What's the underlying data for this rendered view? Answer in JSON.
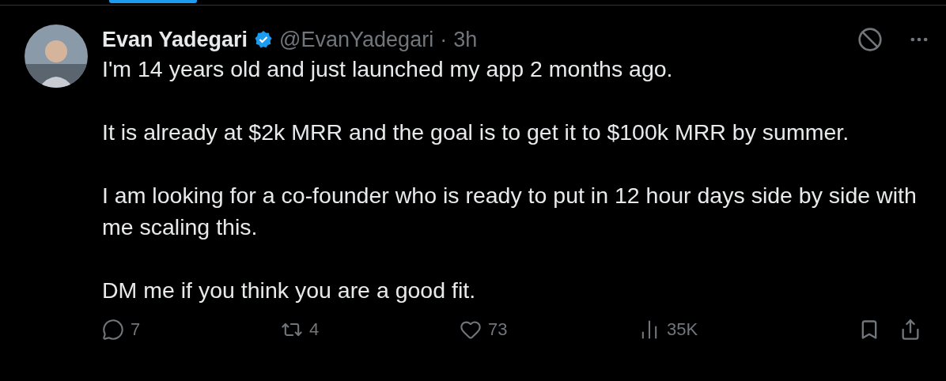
{
  "author": {
    "name": "Evan Yadegari",
    "verified": true,
    "handle": "@EvanYadegari",
    "separator": "·",
    "time": "3h"
  },
  "paragraphs": [
    "I'm 14 years old and just launched my app 2 months ago.",
    "It is already at $2k MRR and the goal is to get it to $100k MRR by summer.",
    "I am looking for a co-founder who is ready to put in 12 hour days side by side with me scaling this.",
    "DM me if you think you are a good fit."
  ],
  "actions": [
    {
      "kind": "reply",
      "count": "7"
    },
    {
      "kind": "repost",
      "count": "4"
    },
    {
      "kind": "like",
      "count": "73"
    },
    {
      "kind": "views",
      "count": "35K"
    }
  ]
}
